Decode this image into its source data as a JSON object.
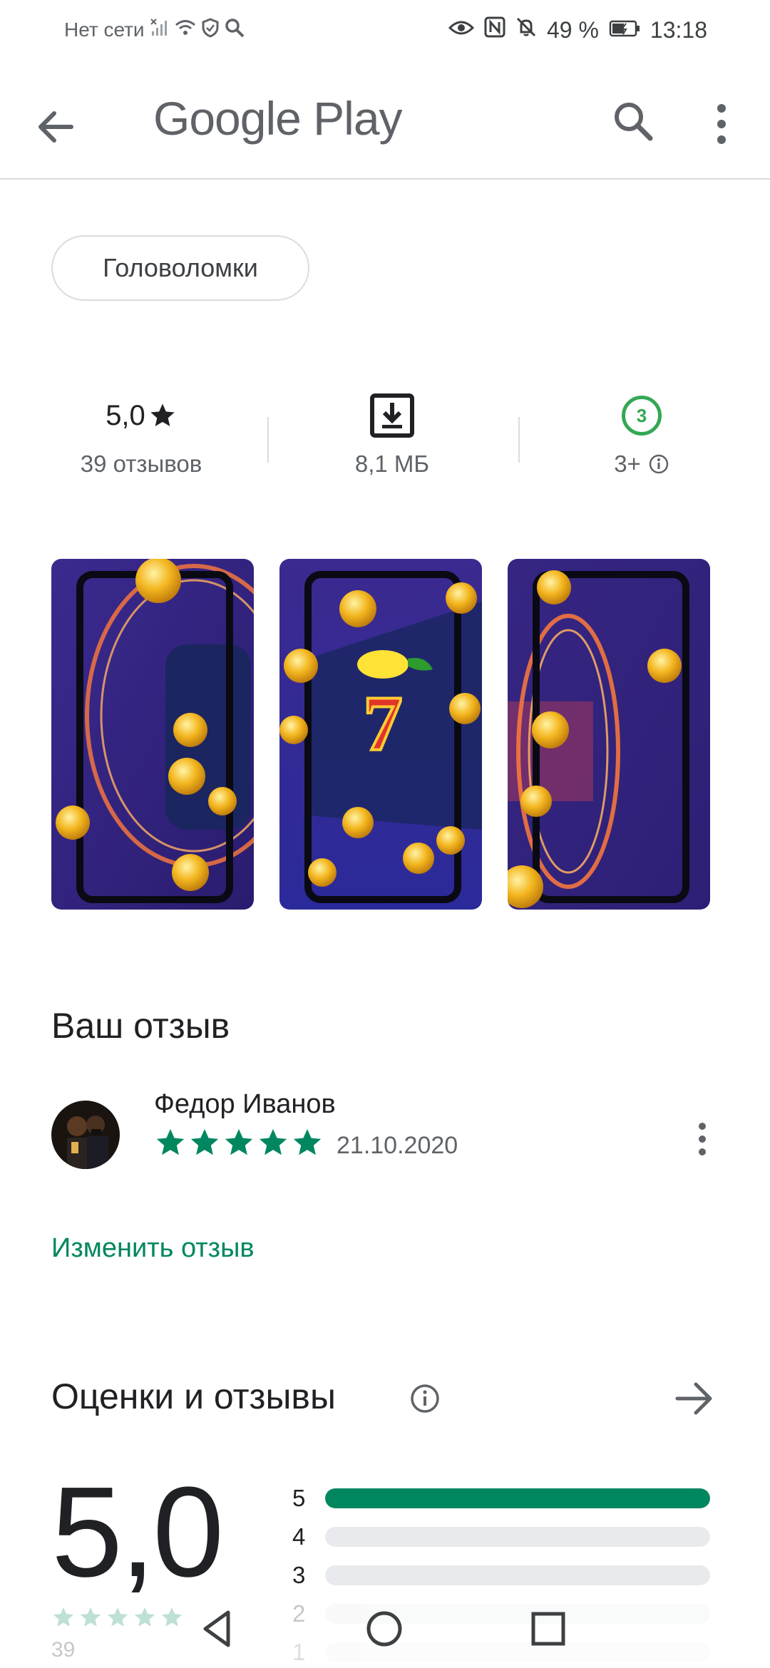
{
  "status_bar": {
    "network": "Нет сети",
    "battery": "49 %",
    "time": "13:18",
    "icons": [
      "no-signal-icon",
      "wifi-icon",
      "shield-icon",
      "search-icon",
      "eye-icon",
      "nfc-icon",
      "bell-off-icon",
      "battery-icon"
    ]
  },
  "app_bar": {
    "title": "Google Play",
    "icons": [
      "back-arrow-icon",
      "search-icon",
      "more-vert-icon"
    ]
  },
  "category_chip": "Головоломки",
  "stats": {
    "rating_value": "5,0",
    "rating_label": "39 отзывов",
    "size_value": "8,1 МБ",
    "age_badge": "3",
    "age_label": "3+"
  },
  "screenshots": [
    {
      "icon": "coins-portal-screenshot"
    },
    {
      "icon": "slot-seven-screenshot"
    },
    {
      "icon": "coins-portal-screenshot"
    }
  ],
  "your_review": {
    "title": "Ваш отзыв",
    "reviewer": "Федор Иванов",
    "stars": 5,
    "date": "21.10.2020",
    "edit_label": "Изменить отзыв"
  },
  "ratings": {
    "title": "Оценки и отзывы",
    "average": "5,0",
    "count": "39",
    "histogram": [
      {
        "label": "5",
        "fraction": 1.0
      },
      {
        "label": "4",
        "fraction": 0.0
      },
      {
        "label": "3",
        "fraction": 0.0
      },
      {
        "label": "2",
        "fraction": 0.0
      },
      {
        "label": "1",
        "fraction": 0.0
      }
    ]
  },
  "colors": {
    "accent": "#01875f",
    "age_badge": "#34a853",
    "text_primary": "#202124",
    "text_secondary": "#5f6368"
  }
}
